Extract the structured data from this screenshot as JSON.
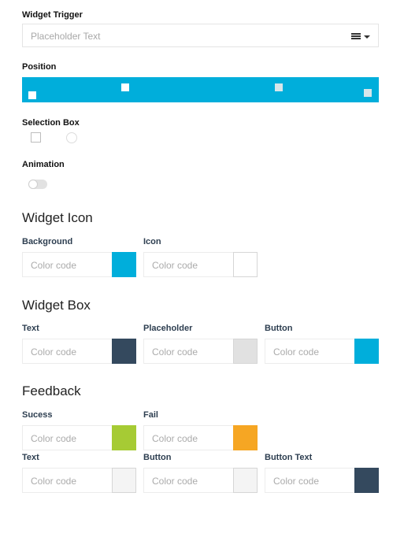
{
  "widget_trigger": {
    "label": "Widget Trigger",
    "placeholder": "Placeholder Text",
    "icons": [
      "menu-icon",
      "caret-down-icon"
    ]
  },
  "position": {
    "label": "Position",
    "bar_color": "#00AEDB"
  },
  "selection_box": {
    "label": "Selection Box"
  },
  "animation": {
    "label": "Animation",
    "enabled": false
  },
  "widget_icon": {
    "title": "Widget Icon",
    "background": {
      "label": "Background",
      "placeholder": "Color code",
      "color": "#00AEDB"
    },
    "icon": {
      "label": "Icon",
      "placeholder": "Color code",
      "color": "#FFFFFF"
    }
  },
  "widget_box": {
    "title": "Widget Box",
    "text": {
      "label": "Text",
      "placeholder": "Color code",
      "color": "#34495E"
    },
    "placeholder": {
      "label": "Placeholder",
      "placeholder": "Color code",
      "color": "#E1E1E1"
    },
    "button": {
      "label": "Button",
      "placeholder": "Color code",
      "color": "#00AEDB"
    }
  },
  "feedback": {
    "title": "Feedback",
    "success": {
      "label": "Sucess",
      "placeholder": "Color code",
      "color": "#A6CB34"
    },
    "fail": {
      "label": "Fail",
      "placeholder": "Color code",
      "color": "#F6A623"
    },
    "text": {
      "label": "Text",
      "placeholder": "Color code",
      "color": "#F4F4F4"
    },
    "button": {
      "label": "Button",
      "placeholder": "Color code",
      "color": "#F4F4F4"
    },
    "button_text": {
      "label": "Button Text",
      "placeholder": "Color code",
      "color": "#34495E"
    }
  }
}
